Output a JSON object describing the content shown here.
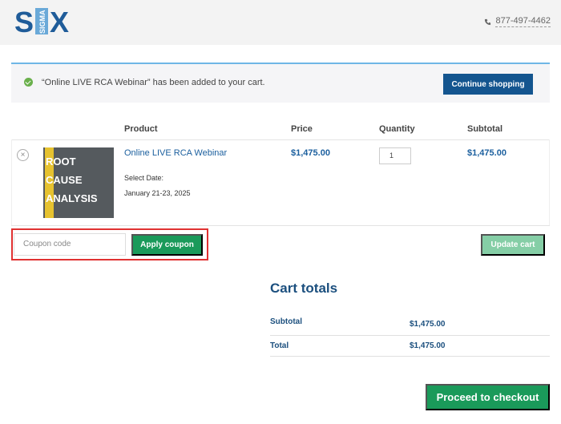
{
  "header": {
    "logo_text": "SIX SIGMA",
    "phone": "877-497-4462",
    "phone_icon": "phone-icon"
  },
  "notice": {
    "message": "“Online LIVE RCA Webinar” has been added to your cart.",
    "continue_label": "Continue shopping",
    "status_color": "#6ab04c"
  },
  "table": {
    "headers": [
      "Product",
      "Price",
      "Quantity",
      "Subtotal"
    ],
    "items": [
      {
        "name": "Online LIVE RCA Webinar",
        "thumb_lines": [
          "ROOT",
          "CAUSE",
          "ANALYSIS"
        ],
        "meta_label": "Select Date:",
        "meta_value": "January 21-23, 2025",
        "price": "$1,475.00",
        "quantity": "1",
        "subtotal": "$1,475.00"
      }
    ]
  },
  "coupon": {
    "placeholder": "Coupon code",
    "apply_label": "Apply coupon"
  },
  "update_label": "Update cart",
  "totals": {
    "title": "Cart totals",
    "subtotal_label": "Subtotal",
    "subtotal_value": "$1,475.00",
    "total_label": "Total",
    "total_value": "$1,475.00"
  },
  "checkout_label": "Proceed to checkout",
  "colors": {
    "brand_blue": "#14558f",
    "accent_green": "#1a9a5a",
    "highlight_red": "#e03131"
  }
}
